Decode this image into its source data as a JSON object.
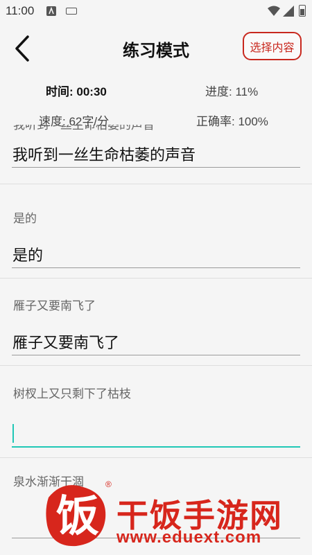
{
  "status_bar": {
    "time": "11:00",
    "icons": [
      "app-a-icon",
      "keyboard-icon",
      "wifi-icon",
      "signal-icon",
      "battery-icon"
    ]
  },
  "header": {
    "title": "练习模式",
    "select_button": "选择内容",
    "accent_color": "#c8281e"
  },
  "stats": {
    "time": "时间: 00:30",
    "progress": "进度: 11%",
    "speed": "速度: 62字/分",
    "accuracy": "正确率: 100%"
  },
  "items": [
    {
      "prompt": "我听到一丝生命枯萎的声音",
      "answer": "我听到一丝生命枯萎的声音"
    },
    {
      "prompt": "是的",
      "answer": "是的"
    },
    {
      "prompt": "雁子又要南飞了",
      "answer": "雁子又要南飞了"
    },
    {
      "prompt": "树杈上又只剩下了枯枝",
      "answer": ""
    },
    {
      "prompt": "泉水渐渐干涸",
      "answer": ""
    }
  ],
  "active_color": "#1fc7b6",
  "watermark": {
    "logo_char": "饭",
    "brand": "干饭手游网",
    "url": "www.eduext.com",
    "reg": "®"
  }
}
